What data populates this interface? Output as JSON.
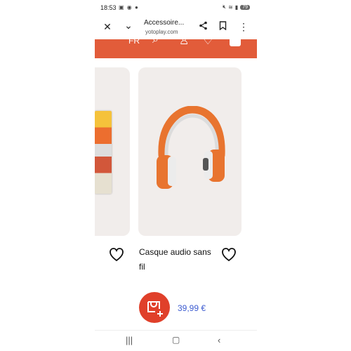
{
  "status_bar": {
    "time": "18:53",
    "left_icons": "▣ ◉ ●",
    "battery": "79"
  },
  "browser": {
    "title": "Accessoire...",
    "url": "yotoplay.com"
  },
  "site_nav": {
    "language": "FR"
  },
  "product": {
    "name": "Casque audio sans fil",
    "price": "39,99 €"
  },
  "colors": {
    "brand_orange": "#e25c3a",
    "cart_red": "#e0402a",
    "price_blue": "#3c5bd0",
    "headphone_orange": "#e8742f"
  },
  "icons": [
    "close-icon",
    "chevron-down-icon",
    "share-icon",
    "bookmark-icon",
    "more-icon",
    "search-icon",
    "user-icon",
    "heart-icon",
    "cart-icon",
    "recent-apps-icon",
    "home-icon",
    "back-icon"
  ]
}
